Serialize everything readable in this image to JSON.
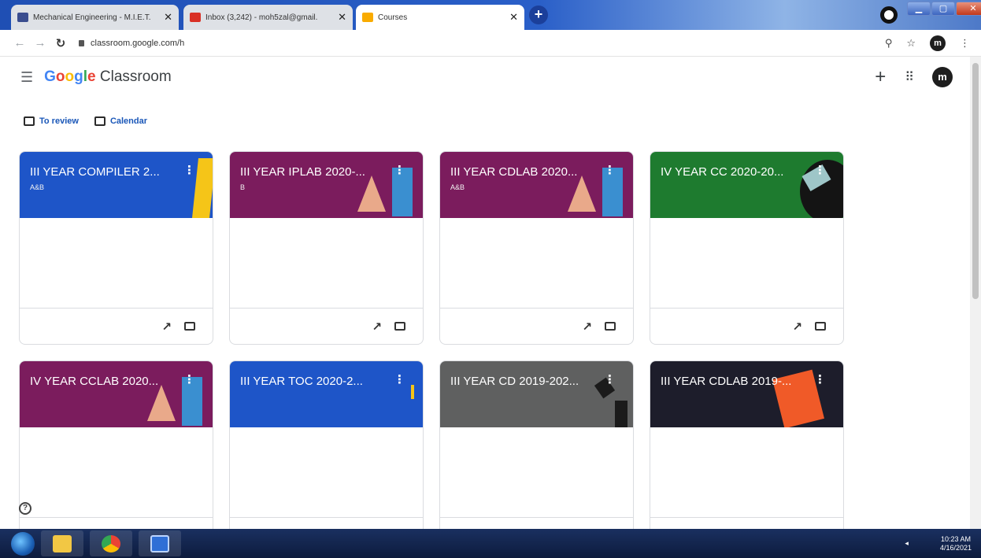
{
  "browser": {
    "tabs": [
      {
        "title": "Mechanical Engineering - M.I.E.T.",
        "favicon_color": "#3a4d8f",
        "active": false
      },
      {
        "title": "Inbox (3,242) - moh5zal@gmail.",
        "favicon_color": "#d93025",
        "active": false
      },
      {
        "title": "Courses",
        "favicon_color": "#f9ab00",
        "active": true
      }
    ],
    "new_tab_label": "+",
    "url": "classroom.google.com/h"
  },
  "app": {
    "logo_google": "Google",
    "logo_product": "Classroom",
    "avatar_initial": "m"
  },
  "links": {
    "to_review": "To review",
    "calendar": "Calendar"
  },
  "courses": [
    {
      "title": "III YEAR COMPILER 2...",
      "section": "A&B",
      "color": "#1e55c8"
    },
    {
      "title": "III YEAR IPLAB 2020-...",
      "section": "B",
      "color": "#7b1c5d"
    },
    {
      "title": "III YEAR CDLAB 2020...",
      "section": "A&B",
      "color": "#7b1c5d"
    },
    {
      "title": "IV YEAR CC 2020-20...",
      "section": "",
      "color": "#1e7b2f"
    },
    {
      "title": "IV YEAR CCLAB 2020...",
      "section": "",
      "color": "#7b1c5d"
    },
    {
      "title": "III YEAR TOC 2020-2...",
      "section": "",
      "color": "#1e55c8"
    },
    {
      "title": "III YEAR CD 2019-202...",
      "section": "",
      "color": "#5f6060"
    },
    {
      "title": "III YEAR CDLAB 2019-...",
      "section": "",
      "color": "#1d1d2b"
    }
  ],
  "icons": {
    "help": "?",
    "kebab": "⋮",
    "trend": "↗"
  },
  "taskbar": {
    "time": "10:23 AM",
    "date": "4/16/2021"
  }
}
